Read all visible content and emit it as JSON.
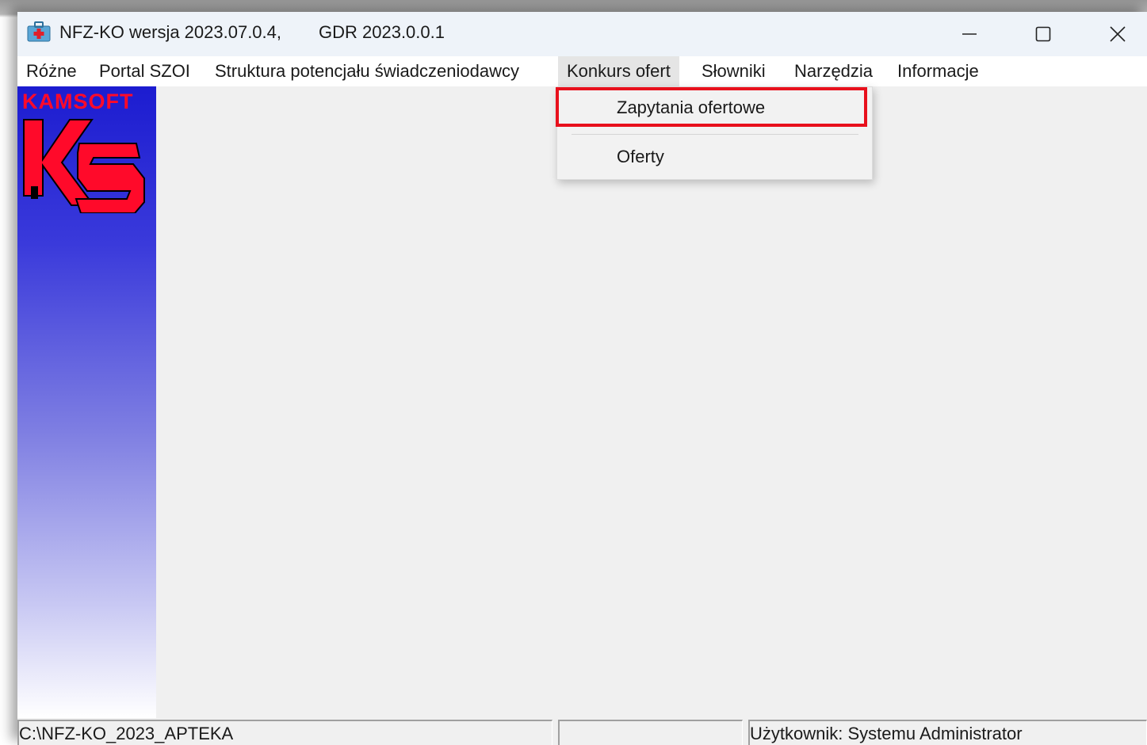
{
  "window": {
    "title": "NFZ-KO wersja 2023.07.0.4,",
    "version": "GDR 2023.0.0.1",
    "controls": {
      "minimize": "minimize-icon",
      "maximize": "maximize-icon",
      "close": "close-icon"
    }
  },
  "menu": {
    "items": [
      "Różne",
      "Portal SZOI",
      "Struktura potencjału świadczeniodawcy",
      "Konkurs ofert",
      "Słowniki",
      "Narzędzia",
      "Informacje"
    ],
    "active": "Konkurs ofert"
  },
  "dropdown": {
    "items": [
      "Zapytania ofertowe",
      "Oferty"
    ],
    "highlighted": "Zapytania ofertowe",
    "highlight_color": "#e8101c"
  },
  "sidebar": {
    "brand": "KAMSOFT",
    "logo": "ks-logo",
    "brand_color": "#ff0a2a"
  },
  "status": {
    "path": "C:\\NFZ-KO_2023_APTEKA",
    "middle": "",
    "user_label": "Użytkownik:",
    "user_name": "Systemu Administrator"
  }
}
